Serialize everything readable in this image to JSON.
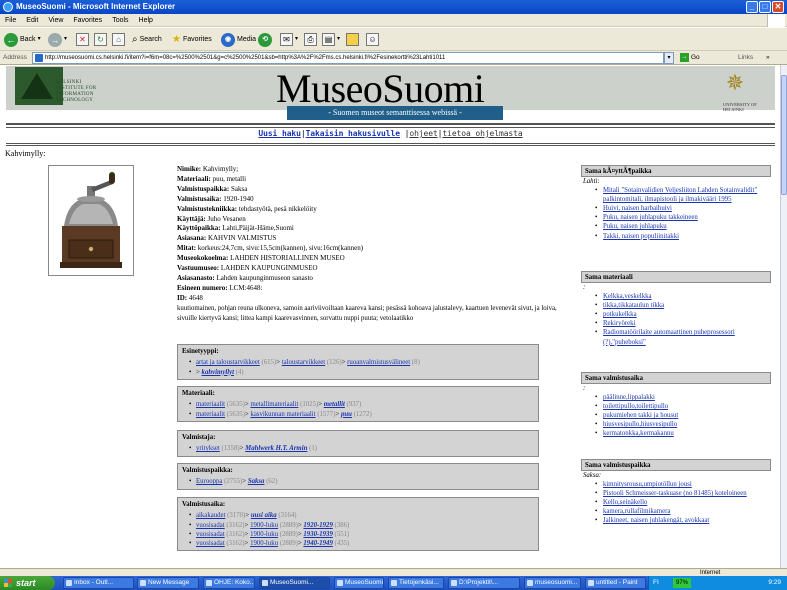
{
  "window": {
    "title": "MuseoSuomi - Microsoft Internet Explorer",
    "minimize": "_",
    "maximize": "□",
    "close": "✕"
  },
  "menu": [
    "File",
    "Edit",
    "View",
    "Favorites",
    "Tools",
    "Help"
  ],
  "toolbar": {
    "back": "Back",
    "search": "Search",
    "favorites": "Favorites",
    "media": "Media"
  },
  "address": {
    "label": "Address",
    "url": "http://museosuomi.cs.helsinki.fi/item?i=f6m=08c=%2500%2501&g=c%2500%2501&sb=http%3A%2F%2Fms.cs.helsinki.fi%2Fesinekortti%23Lahti1011",
    "go": "Go",
    "links": "Links"
  },
  "banner": {
    "hut_text": [
      "HELSINKI",
      "INSTITUTE FOR",
      "INFORMATION",
      "TECHNOLOGY"
    ],
    "site_title": "MuseoSuomi",
    "subtitle": "- Suomen museot semanttisessa webissä -",
    "uh_text": "UNIVERSITY OF HELSINKI"
  },
  "nav": {
    "links": [
      "Uusi haku",
      "Takaisin hakusivulle",
      "ohjeet",
      "tietoa ohjelmasta"
    ]
  },
  "object": {
    "title": "Kahvimylly:",
    "image_alt": "coffee grinder photo",
    "fields": [
      {
        "label": "Nimike:",
        "value": "Kahvimylly;"
      },
      {
        "label": "Materiaali:",
        "value": "puu, metalli"
      },
      {
        "label": "Valmistuspaikka:",
        "value": "Saksa"
      },
      {
        "label": "Valmistusaika:",
        "value": "1920-1940"
      },
      {
        "label": "Valmistustekniikka:",
        "value": "tehdastyötä, pesä nikkelöity"
      },
      {
        "label": "Käyttäjä:",
        "value": "Juho Vesanen"
      },
      {
        "label": "Käyttöpaikka:",
        "value": "Lahti,Päijät-Häme,Suomi"
      },
      {
        "label": "Asiasana:",
        "value": "KAHVIN VALMISTUS"
      },
      {
        "label": "Mitat:",
        "value": "korkeus:24,7cm, sivu:15,5cm(kannen), sivu:16cm(kannen)"
      },
      {
        "label": "Museokokoelma:",
        "value": "LAHDEN HISTORIALLINEN MUSEO"
      },
      {
        "label": "Vastuumuseo:",
        "value": "LAHDEN KAUPUNGINMUSEO"
      },
      {
        "label": "Asiasanasto:",
        "value": "Lahden kaupunginmuseon sanasto"
      },
      {
        "label": "Esineen numero:",
        "value": "LCM:4648:"
      },
      {
        "label": "ID:",
        "value": "4648"
      }
    ],
    "description": "kuutiomainen, pohjan reuna ulkoneva, samoin aariviivoiltaan kaareva kansi; pesässä kohoava jalustalevy, kaartuen levenevät sivut, ja loiva, sivuille kiertyvä kansi; littea kampi kaarevasvinnen, sorvattu nuppi puuta; vetolaatikko"
  },
  "boxes": [
    {
      "heading": "Esinetyyppi:",
      "rows": [
        [
          {
            "t": "artat ja taloustarvikkeet",
            "c": "lk"
          },
          {
            "t": " (615)",
            "c": "gr"
          },
          {
            "t": "> "
          },
          {
            "t": "taloustarvikkeet",
            "c": "lk"
          },
          {
            "t": " (126)",
            "c": "gr"
          },
          {
            "t": "> "
          },
          {
            "t": "ruoanvalmistusvälineet",
            "c": "lk"
          },
          {
            "t": " (8)",
            "c": "gr"
          }
        ],
        [
          {
            "t": "> "
          },
          {
            "t": "kahvimyllyt",
            "c": "bi"
          },
          {
            "t": " (4)",
            "c": "gr"
          }
        ]
      ]
    },
    {
      "heading": "Materiaali:",
      "rows": [
        [
          {
            "t": "materiaalit",
            "c": "lk"
          },
          {
            "t": " (5635)",
            "c": "gr"
          },
          {
            "t": "> "
          },
          {
            "t": "metallimateriaalit",
            "c": "lk"
          },
          {
            "t": " (1025)",
            "c": "gr"
          },
          {
            "t": "> "
          },
          {
            "t": "metallit",
            "c": "bi"
          },
          {
            "t": " (937)",
            "c": "gr"
          }
        ],
        [
          {
            "t": "materiaalit",
            "c": "lk"
          },
          {
            "t": " (5635)",
            "c": "gr"
          },
          {
            "t": "> "
          },
          {
            "t": "kasvikunnan materiaalit",
            "c": "lk"
          },
          {
            "t": " (1577)",
            "c": "gr"
          },
          {
            "t": "> "
          },
          {
            "t": "puu",
            "c": "bi"
          },
          {
            "t": " (1272)",
            "c": "gr"
          }
        ]
      ]
    },
    {
      "heading": "Valmistaja:",
      "rows": [
        [
          {
            "t": "yritykset",
            "c": "lk"
          },
          {
            "t": " (1358)",
            "c": "gr"
          },
          {
            "t": "> "
          },
          {
            "t": "Mahlwerk H.T. Armin",
            "c": "bi"
          },
          {
            "t": " (1)",
            "c": "gr"
          }
        ]
      ]
    },
    {
      "heading": "Valmistuspaikka:",
      "rows": [
        [
          {
            "t": "Eurooppa",
            "c": "lk"
          },
          {
            "t": " (2755)",
            "c": "gr"
          },
          {
            "t": "> "
          },
          {
            "t": "Saksa",
            "c": "bi"
          },
          {
            "t": " (62)",
            "c": "gr"
          }
        ]
      ]
    },
    {
      "heading": "Valmistusaika:",
      "rows": [
        [
          {
            "t": "aikakaudet",
            "c": "lk"
          },
          {
            "t": " (3170)",
            "c": "gr"
          },
          {
            "t": "> "
          },
          {
            "t": "uusi aika",
            "c": "bi"
          },
          {
            "t": " (3164)",
            "c": "gr"
          }
        ],
        [
          {
            "t": "vuosisadat",
            "c": "lk"
          },
          {
            "t": " (3162)",
            "c": "gr"
          },
          {
            "t": "> "
          },
          {
            "t": "1900-luku",
            "c": "lk"
          },
          {
            "t": " (2889)",
            "c": "gr"
          },
          {
            "t": "> "
          },
          {
            "t": "1920-1929",
            "c": "bi"
          },
          {
            "t": " (386)",
            "c": "gr"
          }
        ],
        [
          {
            "t": "vuosisadat",
            "c": "lk"
          },
          {
            "t": " (3162)",
            "c": "gr"
          },
          {
            "t": "> "
          },
          {
            "t": "1900-luku",
            "c": "lk"
          },
          {
            "t": " (2889)",
            "c": "gr"
          },
          {
            "t": "> "
          },
          {
            "t": "1930-1939",
            "c": "bi"
          },
          {
            "t": " (551)",
            "c": "gr"
          }
        ],
        [
          {
            "t": "vuosisadat",
            "c": "lk"
          },
          {
            "t": " (3162)",
            "c": "gr"
          },
          {
            "t": "> "
          },
          {
            "t": "1900-luku",
            "c": "lk"
          },
          {
            "t": " (2889)",
            "c": "gr"
          },
          {
            "t": "> "
          },
          {
            "t": "1940-1949",
            "c": "bi"
          },
          {
            "t": " (435)",
            "c": "gr"
          }
        ]
      ]
    }
  ],
  "side": [
    {
      "heading": "Sama kÃ¤yttÃ¶paikka",
      "context": "Lahti:",
      "items": [
        "Mitali \"Sotainvalidien Veljesliiton Lahden Sotainvalidit\" palkintomitali, ilmapistooli ja ilmakivääri 1995",
        "Huivi, naisen harbaihuivi",
        "Puku, naisen juhlapuku takkeineen",
        "Puku, naisen juhlapuku",
        "Takki, naisen populiinitakki"
      ]
    },
    {
      "heading": "Sama materiaali",
      "context": ":",
      "items": [
        "Kelkka,veskelkka",
        "tikka,tikkataulun tikka",
        "potkukelkka",
        "Rekiryöreki",
        "Radiomatöörilaite automaattinen puheprosessori (?),\"puheboksi\""
      ]
    },
    {
      "heading": "Sama valmistusaika",
      "context": ":",
      "items": [
        "päälinne,lippalakki",
        "toilettipullo,toilettipullo",
        "pukumiehen takki ja housut",
        "hiusvesipullo,hiusvesipullo",
        "kermatonkka,kermakannu"
      ]
    },
    {
      "heading": "Sama valmistuspaikka",
      "context": "Saksa:",
      "items": [
        "kimnitysrousu,umpiotöllun jousi",
        "Pistooli Schmeisser-taskuase (no 81485) koteloineen",
        "Kello,seinäkello",
        "kamera,rullafilmikamera",
        "Jalkineet, naisen juhlakengät, avokkaat"
      ]
    }
  ],
  "status": {
    "zone": "Internet"
  },
  "taskbar": {
    "start": "start",
    "tasks": [
      "Inbox - Outl...",
      "New Message",
      "OHJE: Koko...",
      "MuseoSuomi...",
      "MuseoSuomi...",
      "Tietojenkäsi...",
      "D:\\Projektit\\...",
      "museosuomi...",
      "untitled - Paint"
    ],
    "lang": "FI",
    "battery": "97%",
    "clock": "9:29"
  },
  "colors": {
    "link": "#1a34b0",
    "banner_bg": "#cdd1cc",
    "subtitle_bg": "#1f5f8a",
    "box_bg": "#d3d3d3"
  }
}
